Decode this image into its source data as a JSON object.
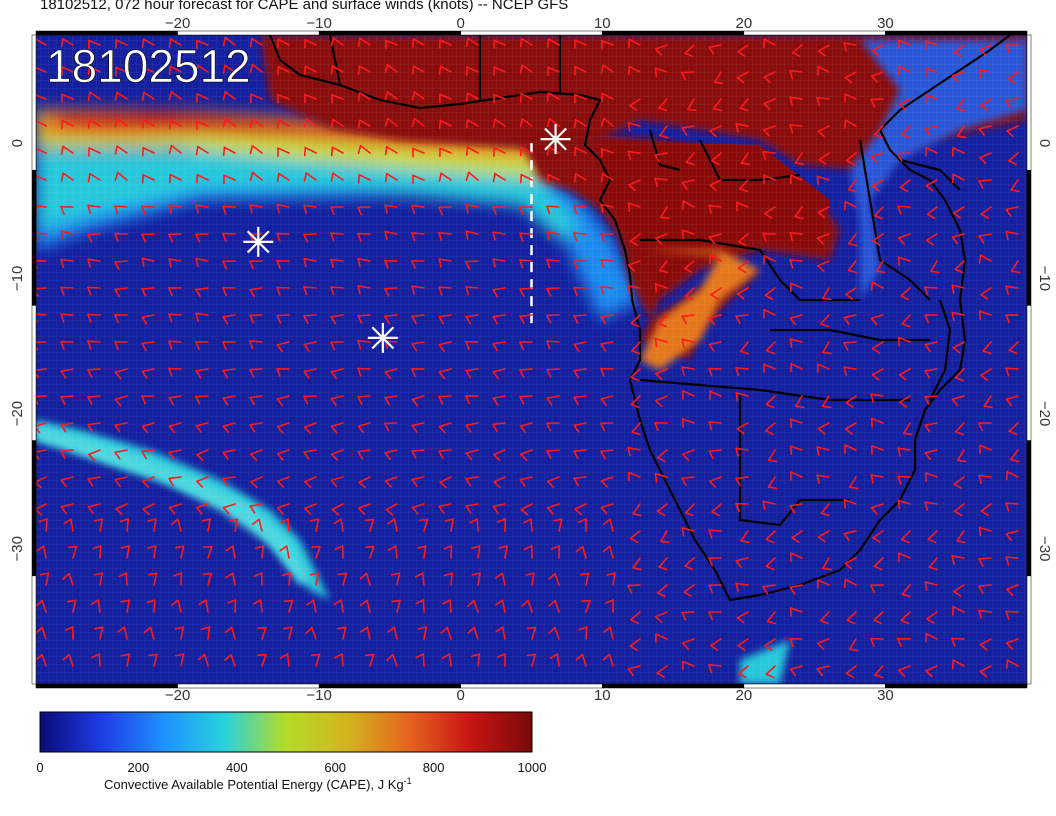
{
  "title": "18102512, 072 hour forecast for CAPE and surface winds (knots) -- NCEP GFS",
  "stamp": "18102512",
  "map": {
    "lon_range": [
      -30,
      40
    ],
    "lat_range": [
      -40,
      8
    ],
    "lon_ticks": [
      "−20",
      "−10",
      "0",
      "10",
      "20",
      "30"
    ],
    "lat_ticks": [
      "0",
      "−10",
      "−20",
      "−30"
    ],
    "barb_color": "#ff1a1a",
    "coast_color": "#000000",
    "markers": [
      {
        "name": "star-marker-1",
        "lon": 6.7,
        "lat": 0.3
      },
      {
        "name": "star-marker-2",
        "lon": -14.3,
        "lat": -7.3
      },
      {
        "name": "star-marker-3",
        "lon": -5.5,
        "lat": -14.4
      }
    ],
    "dashed_line": {
      "lon": 5,
      "lat_from": 0,
      "lat_to": -13.5
    }
  },
  "colorbar": {
    "ticks": [
      "0",
      "200",
      "400",
      "600",
      "800",
      "1000"
    ],
    "label": "Convective Available Potential Energy (CAPE), J Kg",
    "label_sup": "-1",
    "stops": [
      "#0a0a78",
      "#1e3ce6",
      "#1e90ff",
      "#28d2dc",
      "#b4dc28",
      "#d2b41e",
      "#e6641e",
      "#c81414",
      "#780a0a"
    ]
  }
}
